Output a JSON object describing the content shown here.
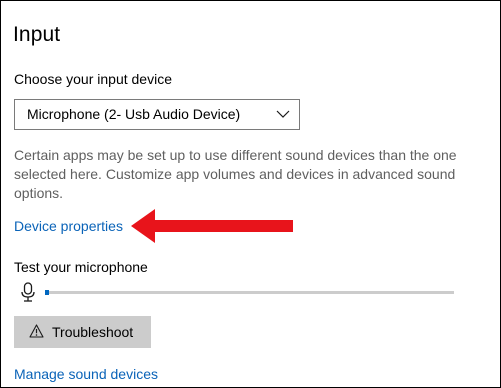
{
  "section": {
    "title": "Input"
  },
  "device": {
    "label": "Choose your input device",
    "selected": "Microphone (2- Usb Audio Device)",
    "chevron_icon": "chevron-down-icon"
  },
  "description": "Certain apps may be set up to use different sound devices than the one selected here. Customize app volumes and devices in advanced sound options.",
  "links": {
    "device_properties": "Device properties",
    "manage_sound_devices": "Manage sound devices"
  },
  "test": {
    "label": "Test your microphone",
    "mic_icon": "microphone-icon",
    "level_percent": 1
  },
  "troubleshoot": {
    "label": "Troubleshoot",
    "icon": "warning-icon"
  },
  "colors": {
    "link": "#0a63b8",
    "accent": "#0067c0",
    "annotation_arrow": "#e8141b",
    "button_bg": "#cccccc",
    "description_text": "#5f5f5f"
  }
}
